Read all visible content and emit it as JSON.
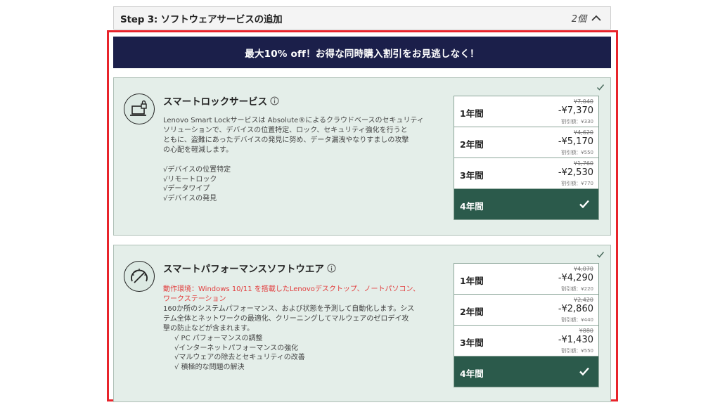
{
  "step": {
    "title": "Step 3: ソフトウェアサービスの追加",
    "count": "2個"
  },
  "banner": {
    "text": "最大10% off！お得な同時購入割引をお見逃しなく！"
  },
  "services": [
    {
      "title": "スマートロックサービス",
      "icon": "lock-laptop-icon",
      "description_lines": [
        "Lenovo Smart Lockサービスは Absolute®によるクラウドベースのセキュリティ",
        "ソリューションで、デバイスの位置特定、ロック、セキュリティ強化を行うと",
        "ともに、盗難にあったデバイスの発見に努め、データ漏洩やなりすましの攻撃",
        "の心配を軽減します。"
      ],
      "features": [
        "√デバイスの位置特定",
        "√リモートロック",
        "√データワイプ",
        "√デバイスの発見"
      ],
      "options": [
        {
          "label": "1年間",
          "old": "¥7,040",
          "price": "-¥7,370",
          "discount": "割引額：¥330"
        },
        {
          "label": "2年間",
          "old": "¥4,620",
          "price": "-¥5,170",
          "discount": "割引額：¥550"
        },
        {
          "label": "3年間",
          "old": "¥1,760",
          "price": "-¥2,530",
          "discount": "割引額：¥770"
        },
        {
          "label": "4年間",
          "selected": true
        }
      ]
    },
    {
      "title": "スマートパフォーマンスソフトウエア",
      "icon": "gauge-icon",
      "requirement_lines": [
        "動作環境：Windows 10/11 を搭載したLenovoデスクトップ、ノートパソコン、",
        "ワークステーション"
      ],
      "description_lines": [
        "160か所のシステムパフォーマンス、および状態を予測して自動化します。シス",
        "テム全体とネットワークの最適化、クリーニングしてマルウェアのゼロデイ攻",
        "撃の防止などが含まれます。"
      ],
      "features": [
        "√ PC パフォーマンスの調整",
        "√インターネットパフォーマンスの強化",
        "√マルウェアの除去とセキュリティの改善",
        "√ 積極的な問題の解決"
      ],
      "options": [
        {
          "label": "1年間",
          "old": "¥4,070",
          "price": "-¥4,290",
          "discount": "割引額：¥220"
        },
        {
          "label": "2年間",
          "old": "¥2,420",
          "price": "-¥2,860",
          "discount": "割引額：¥440"
        },
        {
          "label": "3年間",
          "old": "¥880",
          "price": "-¥1,430",
          "discount": "割引額：¥550"
        },
        {
          "label": "4年間",
          "selected": true
        }
      ]
    }
  ],
  "colors": {
    "banner": "#1b1f4a",
    "card": "#e4eee9",
    "selected": "#2b5a4b",
    "highlight": "#e8242b",
    "requirement": "#e23d3d"
  }
}
